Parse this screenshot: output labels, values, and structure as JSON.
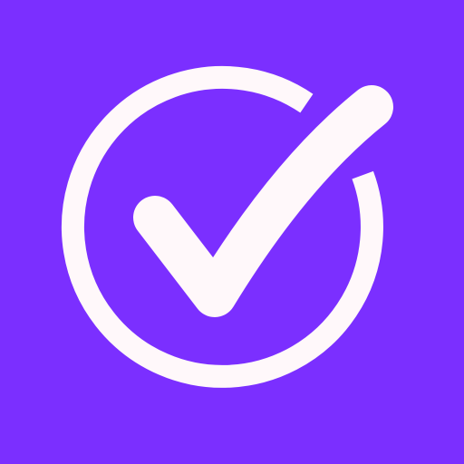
{
  "icon": {
    "name": "checkmark-in-circle-icon",
    "background_color": "#7B2FFF",
    "foreground_color": "#FFF8FA"
  }
}
